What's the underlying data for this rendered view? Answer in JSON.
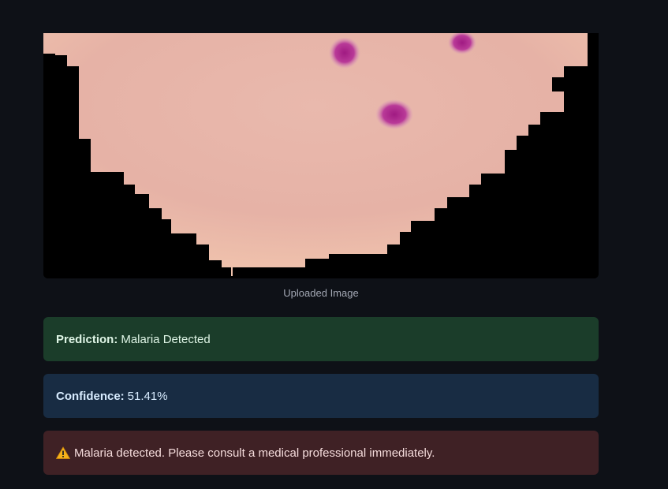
{
  "image": {
    "caption": "Uploaded Image",
    "subject": "blood-cell-micrograph"
  },
  "results": {
    "prediction_label": "Prediction:",
    "prediction_value": "Malaria Detected",
    "confidence_label": "Confidence:",
    "confidence_value": "51.41%",
    "warning_icon": "warning-icon",
    "warning_text": "Malaria detected. Please consult a medical professional immediately."
  },
  "colors": {
    "background": "#0e1117",
    "success_bg": "#1b3d2a",
    "info_bg": "#182c43",
    "error_bg": "#3f2125",
    "cell": "#eec1b0",
    "parasite": "#b5248f"
  }
}
